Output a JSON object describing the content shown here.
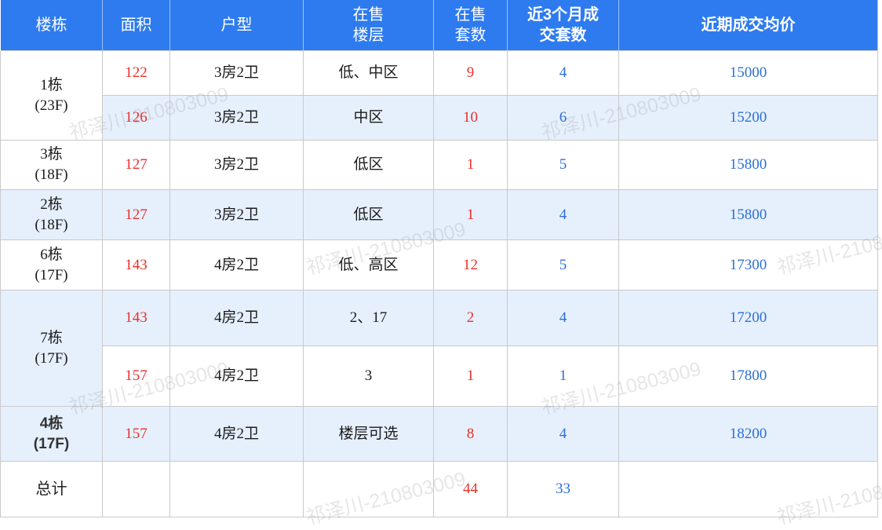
{
  "header": {
    "building": "楼栋",
    "area": "面积",
    "layout": "户型",
    "floors_line1": "在售",
    "floors_line2": "楼层",
    "units_line1": "在售",
    "units_line2": "套数",
    "deals_line1": "近3个月成",
    "deals_line2": "交套数",
    "price": "近期成交均价"
  },
  "buildings": [
    {
      "name": "1栋",
      "floors": "(23F)"
    },
    {
      "name": "3栋",
      "floors": "(18F)"
    },
    {
      "name": "2栋",
      "floors": "(18F)"
    },
    {
      "name": "6栋",
      "floors": "(17F)"
    },
    {
      "name": "7栋",
      "floors": "(17F)"
    },
    {
      "name": "4栋",
      "floors": "(17F)"
    }
  ],
  "rows": [
    {
      "area": "122",
      "layout": "3房2卫",
      "floors": "低、中区",
      "units": "9",
      "deals": "4",
      "price": "15000"
    },
    {
      "area": "126",
      "layout": "3房2卫",
      "floors": "中区",
      "units": "10",
      "deals": "6",
      "price": "15200"
    },
    {
      "area": "127",
      "layout": "3房2卫",
      "floors": "低区",
      "units": "1",
      "deals": "5",
      "price": "15800"
    },
    {
      "area": "127",
      "layout": "3房2卫",
      "floors": "低区",
      "units": "1",
      "deals": "4",
      "price": "15800"
    },
    {
      "area": "143",
      "layout": "4房2卫",
      "floors": "低、高区",
      "units": "12",
      "deals": "5",
      "price": "17300"
    },
    {
      "area": "143",
      "layout": "4房2卫",
      "floors": "2、17",
      "units": "2",
      "deals": "4",
      "price": "17200"
    },
    {
      "area": "157",
      "layout": "4房2卫",
      "floors": "3",
      "units": "1",
      "deals": "1",
      "price": "17800"
    },
    {
      "area": "157",
      "layout": "4房2卫",
      "floors": "楼层可选",
      "units": "8",
      "deals": "4",
      "price": "18200"
    }
  ],
  "total": {
    "label": "总计",
    "units": "44",
    "deals": "33"
  },
  "watermark": {
    "text": "祁泽川-210803009"
  },
  "colors": {
    "header_bg": "#2e7bf0",
    "alt_row_bg": "#e6f0fd",
    "red_value": "#e8302c",
    "blue_value": "#2c6fd6"
  }
}
